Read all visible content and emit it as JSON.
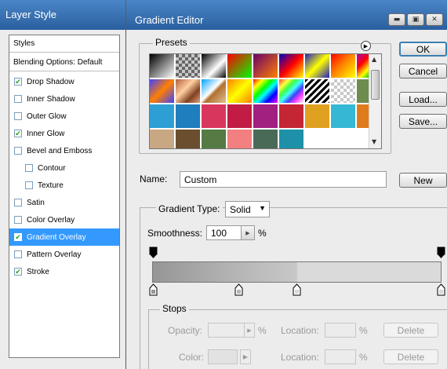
{
  "layer_style": {
    "title": "Layer Style",
    "styles_header": "Styles",
    "blending_options": "Blending Options: Default",
    "items": [
      {
        "label": "Drop Shadow",
        "checked": true,
        "selected": false,
        "sub": false
      },
      {
        "label": "Inner Shadow",
        "checked": false,
        "selected": false,
        "sub": false
      },
      {
        "label": "Outer Glow",
        "checked": false,
        "selected": false,
        "sub": false
      },
      {
        "label": "Inner Glow",
        "checked": true,
        "selected": false,
        "sub": false
      },
      {
        "label": "Bevel and Emboss",
        "checked": false,
        "selected": false,
        "sub": false
      },
      {
        "label": "Contour",
        "checked": false,
        "selected": false,
        "sub": true
      },
      {
        "label": "Texture",
        "checked": false,
        "selected": false,
        "sub": true
      },
      {
        "label": "Satin",
        "checked": false,
        "selected": false,
        "sub": false
      },
      {
        "label": "Color Overlay",
        "checked": false,
        "selected": false,
        "sub": false
      },
      {
        "label": "Gradient Overlay",
        "checked": true,
        "selected": true,
        "sub": false
      },
      {
        "label": "Pattern Overlay",
        "checked": false,
        "selected": false,
        "sub": false
      },
      {
        "label": "Stroke",
        "checked": true,
        "selected": false,
        "sub": false
      }
    ]
  },
  "gradient_editor": {
    "title": "Gradient Editor",
    "title_buttons": [
      "minimize-icon",
      "restore-icon",
      "close-icon"
    ],
    "presets_label": "Presets",
    "presets_menu_icon": "circle-arrow-icon",
    "presets": [
      {
        "bg": "linear-gradient(135deg,#000 0%,#fff 100%)"
      },
      {
        "bg": "checker-dark"
      },
      {
        "bg": "linear-gradient(135deg,#000 0%,#fff 60%,#000 100%)"
      },
      {
        "bg": "linear-gradient(135deg,#f00 0%,#0f0 100%)"
      },
      {
        "bg": "linear-gradient(135deg,#6a006a 0%,#ff8000 100%)"
      },
      {
        "bg": "linear-gradient(135deg,#0000c0 0%,#f00 50%,#ff0 100%)"
      },
      {
        "bg": "linear-gradient(135deg,#2020c0 0%,#ff0 50%,#2020c0 100%)"
      },
      {
        "bg": "linear-gradient(135deg,#f00 0%,#ff8000 45%,#ff0 100%)"
      },
      {
        "bg": "linear-gradient(135deg,#b000b0 0%,#f00 30%,#ff0 55%,#0c0 75%,#00c0ff 100%)"
      },
      {
        "bg": "linear-gradient(135deg,#4040ff 0%,#ff8000 50%,#4040ff 100%)"
      },
      {
        "bg": "linear-gradient(135deg,#b06040 0%,#ffd0a0 40%,#804020 70%,#e0a080 100%)"
      },
      {
        "bg": "linear-gradient(135deg,#00a0ff 0%,#fff 45%,#b07030 55%,#e0c090 100%)"
      },
      {
        "bg": "linear-gradient(135deg,#ff8000 0%,#ff0 50%,#ff8000 100%)"
      },
      {
        "bg": "linear-gradient(135deg,#f00 0%,#ff0 20%,#0f0 40%,#0ff 55%,#00f 75%,#f0f 100%)"
      },
      {
        "bg": "linear-gradient(135deg,#ff4040 0%,#ffff40 20%,#40ff40 35%,#40ffff 50%,#4040ff 65%,#ff40ff 80%,#fff 100%)"
      },
      {
        "bg": "stripes"
      },
      {
        "bg": "checker-light"
      },
      {
        "bg": "#6f8c4f"
      },
      {
        "bg": "#2e9fd4"
      },
      {
        "bg": "#1f7ebd"
      },
      {
        "bg": "#d9365d"
      },
      {
        "bg": "#c21c45"
      },
      {
        "bg": "#a12080"
      },
      {
        "bg": "#c42633"
      },
      {
        "bg": "#e0a020"
      },
      {
        "bg": "#35b8d4"
      },
      {
        "bg": "#e07b1c"
      },
      {
        "bg": "#c8a882"
      },
      {
        "bg": "#6a4e2e"
      },
      {
        "bg": "#557a43"
      },
      {
        "bg": "#f28080"
      },
      {
        "bg": "#4a6a58"
      },
      {
        "bg": "#1e90a8"
      }
    ],
    "ok_label": "OK",
    "cancel_label": "Cancel",
    "load_label": "Load...",
    "save_label": "Save...",
    "name_label": "Name:",
    "name_value": "Custom",
    "new_label": "New",
    "gradient_type_label": "Gradient Type:",
    "gradient_type_value": "Solid",
    "smoothness_label": "Smoothness:",
    "smoothness_value": "100",
    "smoothness_unit": "%",
    "gradient_colors": [
      "#969696",
      "#dadada"
    ],
    "stops_label": "Stops",
    "opacity_label": "Opacity:",
    "opacity_unit": "%",
    "location_label": "Location:",
    "location_unit": "%",
    "delete_label": "Delete",
    "color_label": "Color:"
  }
}
